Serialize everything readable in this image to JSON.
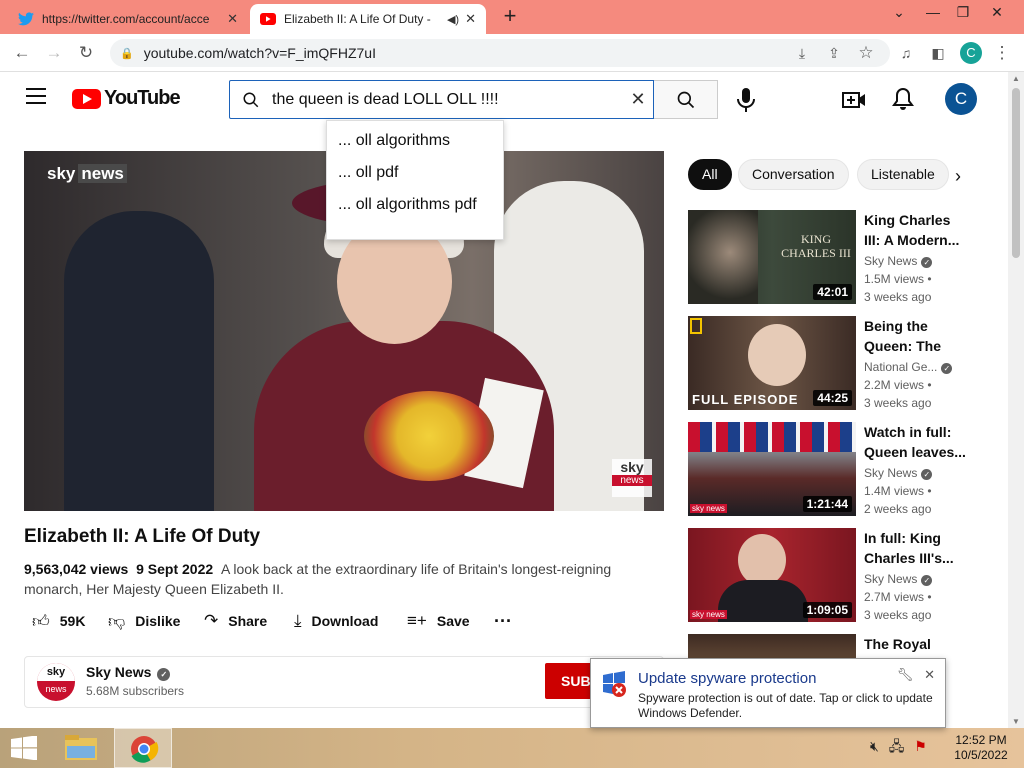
{
  "browser": {
    "tabs": [
      {
        "title": "https://twitter.com/account/acce",
        "active": false
      },
      {
        "title": "Elizabeth II: A Life Of Duty -",
        "active": true
      }
    ],
    "url": "youtube.com/watch?v=F_imQFHZ7uI",
    "profile_initial": "C"
  },
  "youtube": {
    "logo_text": "YouTube",
    "search_query": "the queen is dead LOLL OLL !!!!",
    "suggestions": [
      "... oll algorithms",
      "... oll pdf",
      "... oll algorithms pdf"
    ],
    "avatar_initial": "C"
  },
  "video": {
    "overlay_logo_sky": "sky",
    "overlay_logo_news": "news",
    "title": "Elizabeth II: A Life Of Duty",
    "views": "9,563,042 views",
    "date": "9 Sept 2022",
    "description": "A look back at the extraordinary life of Britain's longest-reigning monarch, Her Majesty Queen Elizabeth II.",
    "actions": {
      "likes": "59K",
      "dislike": "Dislike",
      "share": "Share",
      "download": "Download",
      "save": "Save"
    },
    "channel": {
      "name": "Sky News",
      "subscribers": "5.68M subscribers",
      "subscribe_label": "SUB",
      "logo_top": "sky",
      "logo_bottom": "news"
    }
  },
  "chips": [
    "All",
    "Conversation",
    "Listenable"
  ],
  "recommendations": [
    {
      "title": "King Charles III: A Modern...",
      "channel": "Sky News",
      "views": "1.5M views",
      "age": "3 weeks ago",
      "duration": "42:01",
      "thumb_text": "KING CHARLES III"
    },
    {
      "title": "Being the Queen: The Li...",
      "channel": "National Ge...",
      "views": "2.2M views",
      "age": "3 weeks ago",
      "duration": "44:25",
      "thumb_text": "FULL EPISODE"
    },
    {
      "title": "Watch in full: Queen leaves...",
      "channel": "Sky News",
      "views": "1.4M views",
      "age": "2 weeks ago",
      "duration": "1:21:44",
      "thumb_text": "sky news"
    },
    {
      "title": "In full: King Charles III's...",
      "channel": "Sky News",
      "views": "2.7M views",
      "age": "3 weeks ago",
      "duration": "1:09:05",
      "thumb_text": "sky news"
    },
    {
      "title": "The Royal",
      "channel": "",
      "views": "",
      "age": "",
      "duration": "",
      "thumb_text": ""
    }
  ],
  "notification": {
    "title": "Update spyware protection",
    "body": "Spyware protection is out of date. Tap or click to update Windows Defender."
  },
  "taskbar": {
    "time": "12:52 PM",
    "date": "10/5/2022"
  },
  "colors": {
    "tabstrip": "#f58a7e",
    "youtube_red": "#ff0000",
    "search_border": "#1c62b9",
    "subscribe": "#cc0000"
  }
}
